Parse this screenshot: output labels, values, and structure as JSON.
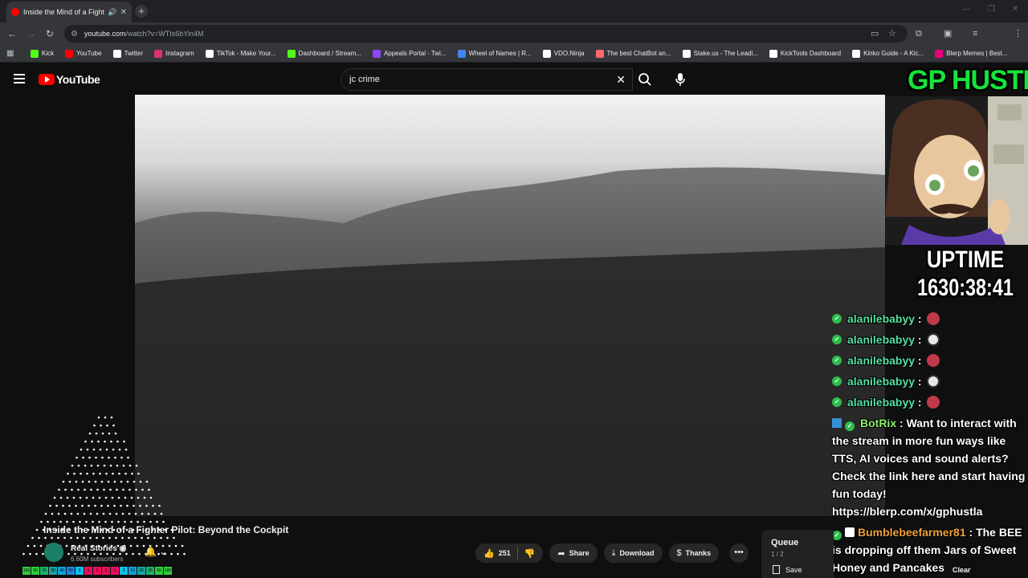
{
  "browser": {
    "tab": {
      "title": "Inside the Mind of a Fighte",
      "favicon": "youtube-icon"
    },
    "url": {
      "host": "youtube.com",
      "path": "/watch?v=WTIs6bYin4M"
    },
    "bookmarks": [
      {
        "label": "Kick",
        "color": "#53fc18"
      },
      {
        "label": "YouTube",
        "color": "#ff0000"
      },
      {
        "label": "Twitter",
        "color": "#ffffff"
      },
      {
        "label": "Instagram",
        "color": "#e1306c"
      },
      {
        "label": "TikTok - Make Your...",
        "color": "#ffffff"
      },
      {
        "label": "Dashboard / Stream...",
        "color": "#53fc18"
      },
      {
        "label": "Appeals Portal - Twi...",
        "color": "#9146ff"
      },
      {
        "label": "Wheel of Names | R...",
        "color": "#4285f4"
      },
      {
        "label": "VDO.Ninja",
        "color": "#ffffff"
      },
      {
        "label": "The best ChatBot an...",
        "color": "#ff6b6b"
      },
      {
        "label": "Stake.us - The Leadi...",
        "color": "#ffffff"
      },
      {
        "label": "KickTools Dashboard",
        "color": "#ffffff"
      },
      {
        "label": "Kinko Guide - A Kic...",
        "color": "#ffffff"
      },
      {
        "label": "Blerp Memes | Best...",
        "color": "#e6007a"
      }
    ]
  },
  "youtube": {
    "logo_text": "YouTube",
    "search": {
      "query": "jc crime"
    },
    "video": {
      "title": "Inside the Mind of a Fighter Pilot: Beyond the Cockpit",
      "channel": "Real Stories",
      "subscribers": "6.60M subscribers",
      "likes": "251",
      "share_label": "Share",
      "download_label": "Download",
      "thanks_label": "Thanks"
    },
    "queue": {
      "title": "Queue",
      "position": "1 / 2",
      "save_label": "Save",
      "clear_label": "Clear"
    }
  },
  "overlay": {
    "brand": "GP HUSTLA",
    "uptime_label": "UPTIME",
    "uptime_value": "1630:38:41",
    "chat": [
      {
        "user": "alanilebabyy",
        "emote": "a"
      },
      {
        "user": "alanilebabyy",
        "emote": "b"
      },
      {
        "user": "alanilebabyy",
        "emote": "a"
      },
      {
        "user": "alanilebabyy",
        "emote": "b"
      },
      {
        "user": "alanilebabyy",
        "emote": "a"
      }
    ],
    "bot_message": {
      "user": "BotRix",
      "text": "Want to interact with the stream in more fun ways like TTS, AI voices and sound alerts? Check the link here and start having fun today! https://blerp.com/x/gphustla"
    },
    "bee_message": {
      "user": "Bumblebeefarmer81",
      "text": "The BEE is dropping off them Jars of Sweet Honey and Pancakes"
    },
    "color_bar": [
      "100",
      "90",
      "25",
      "30",
      "40",
      "50",
      "3",
      "1",
      "1",
      "2",
      "1",
      "3",
      "10",
      "20",
      "25",
      "50",
      "100"
    ]
  }
}
